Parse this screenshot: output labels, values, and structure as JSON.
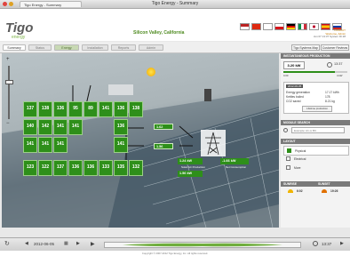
{
  "window": {
    "title": "Tigo Energy - Summary",
    "tab_title": "Tigo Energy - Summary"
  },
  "header": {
    "logo_text": "Tigo",
    "logo_sub": "energy",
    "location": "Silicon Valley, California",
    "info_lines": [
      "LOGOUT",
      "Welcome, Admin",
      "Jun 07 13:37   System ID 28"
    ]
  },
  "tabs": [
    {
      "label": "Summary"
    },
    {
      "label": "Status"
    },
    {
      "label": "Energy"
    },
    {
      "label": "Installation"
    },
    {
      "label": "Reports"
    },
    {
      "label": "Admin"
    }
  ],
  "top_buttons": {
    "system_map": "Tigo Systems Map",
    "customer_reviews": "Customer Reviews"
  },
  "panels": [
    {
      "v": "137"
    },
    {
      "v": "138"
    },
    {
      "v": "136"
    },
    {
      "v": "95"
    },
    {
      "v": "89"
    },
    {
      "v": "141"
    },
    {
      "v": "136"
    },
    {
      "v": "138"
    },
    {
      "v": "140"
    },
    {
      "v": "142"
    },
    {
      "v": "141"
    },
    {
      "v": "141"
    },
    {
      "v": "136"
    },
    {
      "v": "141"
    },
    {
      "v": "141"
    },
    {
      "v": "141"
    },
    {
      "v": "141"
    },
    {
      "v": "123"
    },
    {
      "v": "122"
    },
    {
      "v": "137"
    },
    {
      "v": "136"
    },
    {
      "v": "136"
    },
    {
      "v": "133"
    },
    {
      "v": "135"
    },
    {
      "v": "132"
    }
  ],
  "string_values": {
    "a": "1.62",
    "b": "1.56"
  },
  "power": {
    "solar_value": "1.24 kW",
    "solar_label": "Solar AC Production",
    "net_value": "-1.66 kW",
    "net_label": "Net Consumption",
    "total_value": "1.56 kW"
  },
  "instant": {
    "title": "INSTANTANEOUS PRODUCTION",
    "power_value": "3.20 kW",
    "time_value": "13:37",
    "scale_min": "0.00",
    "scale_max": "4 kW"
  },
  "energy_box": {
    "date": "2012-06-05",
    "rows": [
      {
        "label": "Energy generation",
        "value": "17.17 kWh"
      },
      {
        "label": "Kettles boiled",
        "value": "178"
      },
      {
        "label": "CO2 saved",
        "value": "8.21 kg"
      }
    ],
    "link": "Lifetime production"
  },
  "module_search": {
    "title": "MODULE SEARCH",
    "placeholder": "Example: A1 or B3"
  },
  "layout": {
    "title": "LAYOUT",
    "options": [
      "Physical",
      "Electrical",
      "More"
    ]
  },
  "sun": {
    "sunrise_label": "SUNRISE",
    "sunset_label": "SUNSET",
    "sunrise": "6:02",
    "sunset": "19:26"
  },
  "bottom": {
    "date": "2012-06-05",
    "time": "13:37"
  },
  "footer": "Copyright © 2007-2012 Tigo Energy, Inc. All rights reserved.",
  "colors": {
    "panel_green": "#2e8f1a",
    "accent_orange": "#c57a00",
    "brand_green": "#80b54c"
  }
}
